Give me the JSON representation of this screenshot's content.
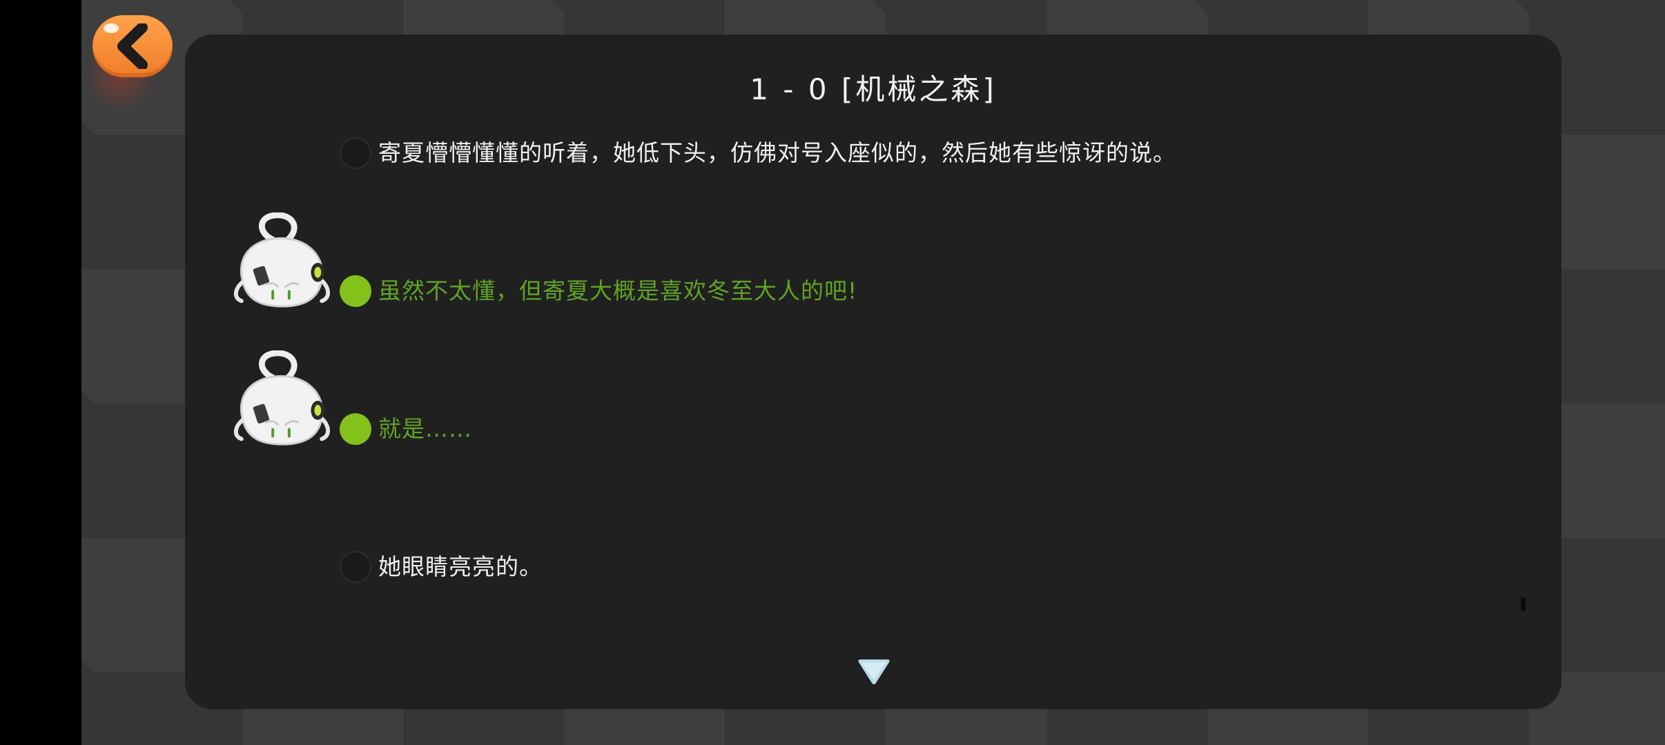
{
  "colors": {
    "back_button": "#f58a30",
    "panel": "#202020",
    "accent_green": "#84c11b",
    "speaker_text_green": "#5fa322",
    "narration_text": "#f0f0f0"
  },
  "back_button": {
    "icon": "chevron-left-icon"
  },
  "chapter_title": "1 - 0 [机械之森]",
  "dialogue": [
    {
      "speaker": "narrator",
      "text": "寄夏懵懵懂懂的听着，她低下头，仿佛对号入座似的，然后她有些惊讶的说。"
    },
    {
      "speaker": "character",
      "text": "虽然不太懂，但寄夏大概是喜欢冬至大人的吧!"
    },
    {
      "speaker": "character",
      "text": "就是……"
    },
    {
      "speaker": "narrator",
      "text": "她眼睛亮亮的。"
    }
  ],
  "next_indicator": {
    "icon": "down-triangle-icon"
  }
}
